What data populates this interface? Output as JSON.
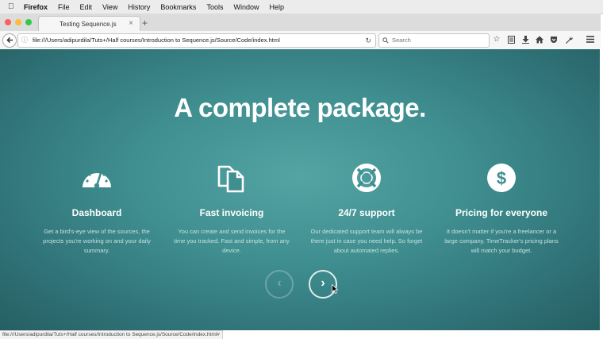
{
  "menubar": {
    "app": "Firefox",
    "items": [
      "File",
      "Edit",
      "View",
      "History",
      "Bookmarks",
      "Tools",
      "Window",
      "Help"
    ]
  },
  "tab": {
    "title": "Testing Sequence.js",
    "close": "×"
  },
  "newtab": "+",
  "nav": {
    "url": "file:///Users/adipurdila/Tuts+/Half courses/Introduction to Sequence.js/Source/Code/index.html",
    "search_placeholder": "Search"
  },
  "page": {
    "headline": "A complete package.",
    "features": [
      {
        "icon": "dashboard-icon",
        "title": "Dashboard",
        "text": "Get a bird's-eye view of the sources, the projects you're working on and your daily summary."
      },
      {
        "icon": "documents-icon",
        "title": "Fast invoicing",
        "text": "You can create and send invoices for the time you tracked. Fast and simple, from any device."
      },
      {
        "icon": "lifebuoy-icon",
        "title": "24/7 support",
        "text": "Our dedicated support team will always be there just in case you need help. So forget about automated replies."
      },
      {
        "icon": "dollar-icon",
        "title": "Pricing for everyone",
        "text": "It doesn't matter if you're a freelancer or a large company. TimeTracker's pricing plans will match your budget."
      }
    ],
    "prev": "‹",
    "next": "›"
  },
  "status": "file:///Users/adipurdila/Tuts+/Half courses/Introduction to Sequence.js/Source/Code/index.html#",
  "colors": {
    "teal_center": "#55a4a4",
    "teal_edge": "#255f63"
  }
}
